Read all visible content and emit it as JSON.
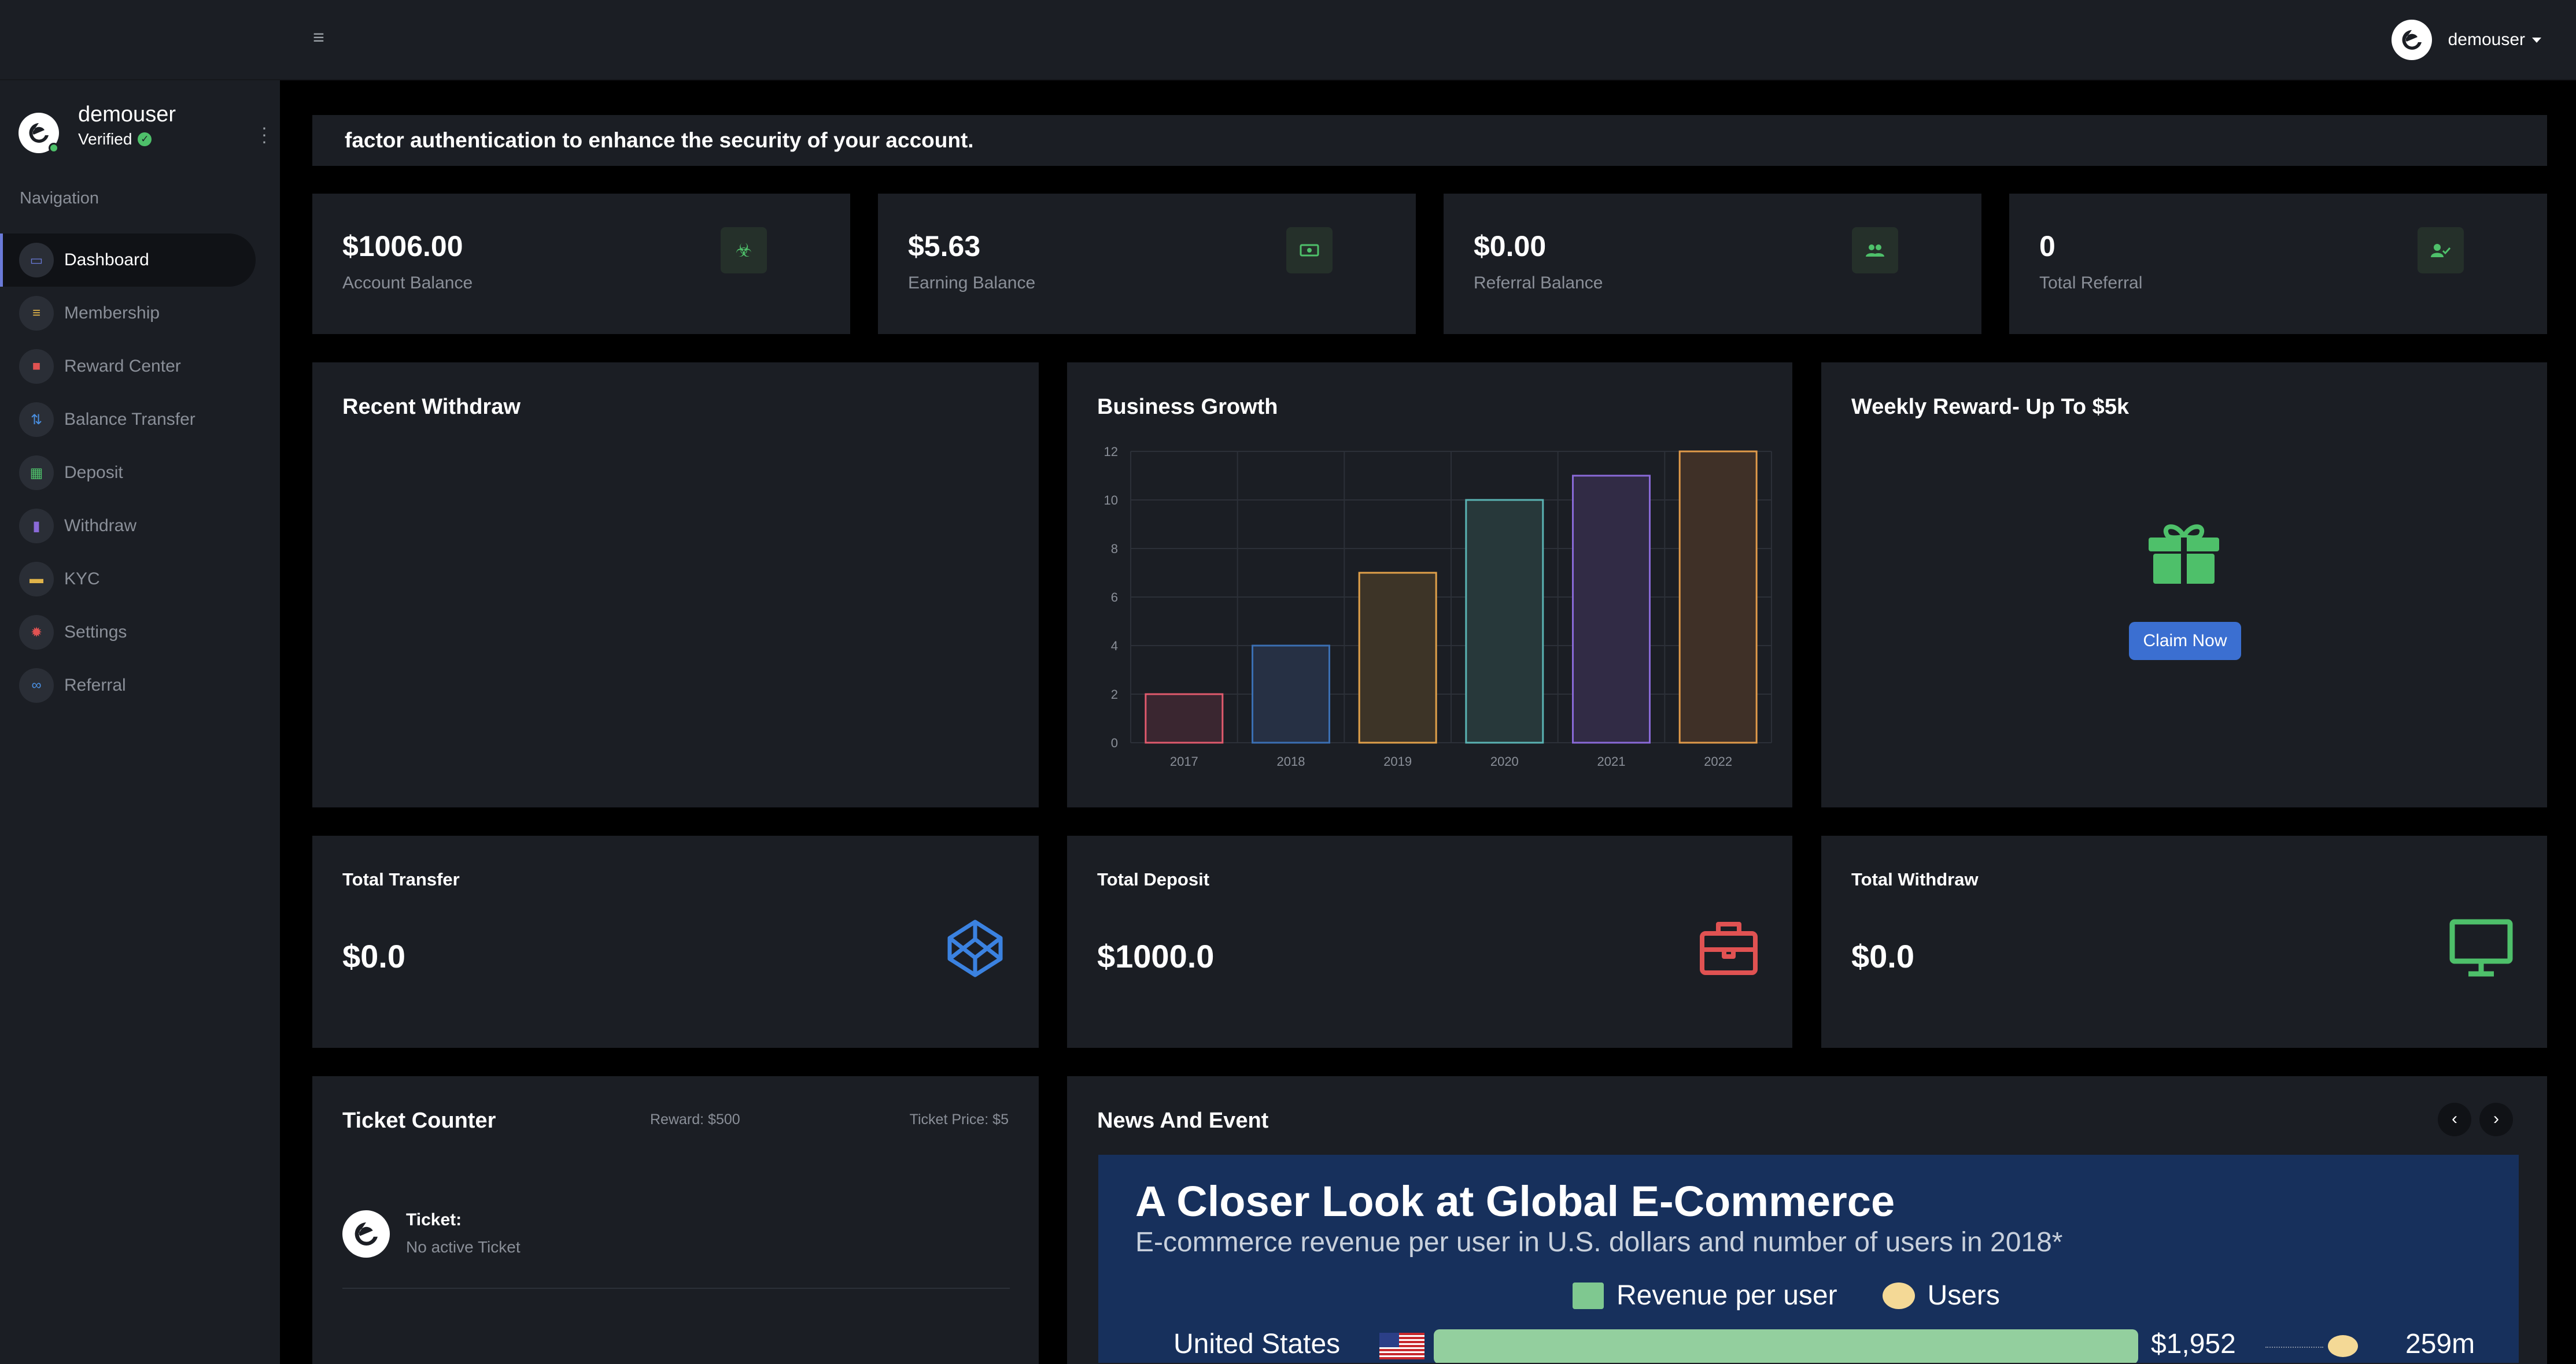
{
  "topbar": {
    "user_name": "demouser"
  },
  "sidebar": {
    "user_name": "demouser",
    "verified_label": "Verified",
    "nav_heading": "Navigation",
    "items": [
      {
        "label": "Dashboard",
        "icon": "monitor-icon",
        "color": "#6a7ad8",
        "active": true
      },
      {
        "label": "Membership",
        "icon": "membership-icon",
        "color": "#e0b34a"
      },
      {
        "label": "Reward Center",
        "icon": "gift-icon",
        "color": "#e05252"
      },
      {
        "label": "Balance Transfer",
        "icon": "transfer-icon",
        "color": "#4a8fe0"
      },
      {
        "label": "Deposit",
        "icon": "table-icon",
        "color": "#4ec06a"
      },
      {
        "label": "Withdraw",
        "icon": "bar-chart-icon",
        "color": "#8a6ad8"
      },
      {
        "label": "KYC",
        "icon": "id-card-icon",
        "color": "#e0b34a"
      },
      {
        "label": "Settings",
        "icon": "gear-icon",
        "color": "#e05252"
      },
      {
        "label": "Referral",
        "icon": "link-icon",
        "color": "#4a8fe0"
      }
    ]
  },
  "banner": {
    "text": "factor authentication to enhance the security of your account."
  },
  "stats": [
    {
      "value": "$1006.00",
      "label": "Account Balance",
      "icon": "biohazard-icon"
    },
    {
      "value": "$5.63",
      "label": "Earning Balance",
      "icon": "money-icon"
    },
    {
      "value": "$0.00",
      "label": "Referral Balance",
      "icon": "users-icon"
    },
    {
      "value": "0",
      "label": "Total Referral",
      "icon": "user-check-icon"
    }
  ],
  "recent_withdraw": {
    "title": "Recent Withdraw"
  },
  "business_growth": {
    "title": "Business Growth"
  },
  "chart_data": {
    "type": "bar",
    "title": "Business Growth",
    "categories": [
      "2017",
      "2018",
      "2019",
      "2020",
      "2021",
      "2022"
    ],
    "values": [
      2,
      4,
      7,
      10,
      11,
      12
    ],
    "ylim": [
      0,
      12
    ],
    "yticks": [
      0,
      2,
      4,
      6,
      8,
      10,
      12
    ],
    "grid": true,
    "colors": [
      {
        "stroke": "#e05a6d",
        "fill": "#3a2630"
      },
      {
        "stroke": "#3b6fb3",
        "fill": "#263044"
      },
      {
        "stroke": "#e0a04a",
        "fill": "#3d3427"
      },
      {
        "stroke": "#5ab3b3",
        "fill": "#27383a"
      },
      {
        "stroke": "#8a6ad8",
        "fill": "#312b45"
      },
      {
        "stroke": "#e09a4a",
        "fill": "#3f3027"
      }
    ]
  },
  "weekly_reward": {
    "title": "Weekly Reward- Up To $5k",
    "button": "Claim Now"
  },
  "totals": [
    {
      "title": "Total Transfer",
      "value": "$0.0",
      "icon": "codepen-icon",
      "color": "#3b82e0"
    },
    {
      "title": "Total Deposit",
      "value": "$1000.0",
      "icon": "briefcase-icon",
      "color": "#e05252"
    },
    {
      "title": "Total Withdraw",
      "value": "$0.0",
      "icon": "desktop-icon",
      "color": "#4ec06a"
    }
  ],
  "ticket_counter": {
    "title": "Ticket Counter",
    "reward": "Reward: $500",
    "price": "Ticket Price: $5",
    "ticket_label": "Ticket:",
    "ticket_status": "No active Ticket"
  },
  "news": {
    "title": "News And Event",
    "prev": "‹",
    "next": "›",
    "image": {
      "title": "A Closer Look at Global E-Commerce",
      "subtitle": "E-commerce revenue per user in U.S. dollars and number of users in 2018*",
      "legend_revenue": "Revenue per user",
      "legend_users": "Users",
      "country": "United States",
      "revenue": "$1,952",
      "users": "259m"
    }
  }
}
